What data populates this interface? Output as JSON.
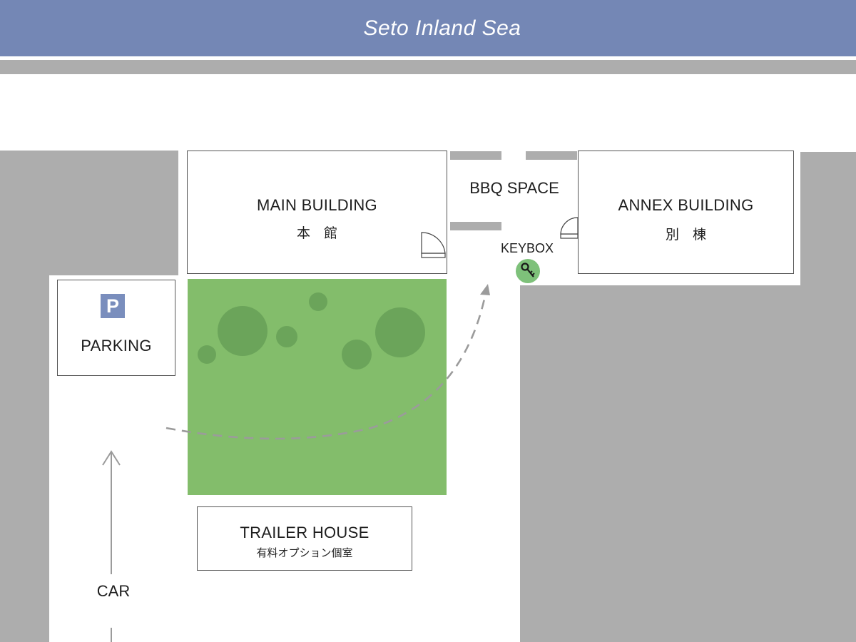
{
  "colors": {
    "sea": "#7487b5",
    "ground": "#adadad",
    "garden": "#83bd6b",
    "tree": "#6ba45a",
    "parking_badge": "#7a8ebd",
    "keybox": "#7ec17a",
    "path": "#9b9b9b"
  },
  "sea": {
    "label": "Seto Inland Sea"
  },
  "buildings": {
    "main": {
      "name_en": "MAIN BUILDING",
      "name_jp": "本　館"
    },
    "annex": {
      "name_en": "ANNEX BUILDING",
      "name_jp": "別　棟"
    },
    "trailer": {
      "name_en": "TRAILER HOUSE",
      "name_jp": "有料オプション個室"
    }
  },
  "areas": {
    "bbq": "BBQ SPACE",
    "keybox": {
      "label": "KEYBOX",
      "icon": "key-icon"
    },
    "parking": {
      "label": "PARKING",
      "badge": "P"
    },
    "car": "CAR"
  }
}
